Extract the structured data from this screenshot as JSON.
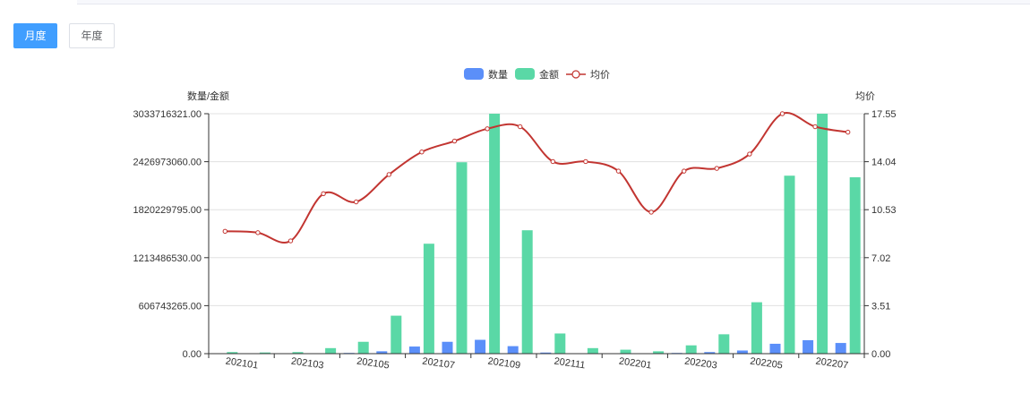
{
  "controls": {
    "month_label": "月度",
    "year_label": "年度"
  },
  "colors": {
    "quantity": "#5b8ff9",
    "amount": "#5ad8a6",
    "avg": "#c23531",
    "grid": "#e0e0e0",
    "axis": "#333333"
  },
  "chart_data": {
    "type": "bar",
    "legend": [
      "数量",
      "金额",
      "均价"
    ],
    "legend_position": "top-center",
    "ylabel_left": "数量/金额",
    "ylabel_right": "均价",
    "left_ticks": [
      "0.00",
      "606743265.00",
      "1213486530.00",
      "1820229795.00",
      "2426973060.00",
      "3033716321.00"
    ],
    "right_ticks": [
      "0.00",
      "3.51",
      "7.02",
      "10.53",
      "14.04",
      "17.55"
    ],
    "ylim_left": [
      0,
      3033716321
    ],
    "ylim_right": [
      0,
      17.55
    ],
    "categories": [
      "202101",
      "202102",
      "202103",
      "202104",
      "202105",
      "202106",
      "202107",
      "202108",
      "202109",
      "202110",
      "202111",
      "202112",
      "202201",
      "202202",
      "202203",
      "202204",
      "202205",
      "202206",
      "202207",
      "202208"
    ],
    "x_tick_labels": [
      "202101",
      "202103",
      "202105",
      "202107",
      "202109",
      "202111",
      "202201",
      "202203",
      "202205",
      "202207"
    ],
    "series": [
      {
        "name": "数量",
        "type": "bar",
        "axis": "left",
        "values": [
          2000000,
          1500000,
          2000000,
          5000000,
          9000000,
          30000000,
          90000000,
          150000000,
          175000000,
          95000000,
          14000000,
          4000000,
          5000000,
          3000000,
          9000000,
          20000000,
          40000000,
          125000000,
          170000000,
          135000000
        ]
      },
      {
        "name": "金额",
        "type": "bar",
        "axis": "left",
        "values": [
          20000000,
          15000000,
          20000000,
          70000000,
          150000000,
          480000000,
          1390000000,
          2420000000,
          3033716321,
          1560000000,
          255000000,
          70000000,
          50000000,
          30000000,
          105000000,
          245000000,
          650000000,
          2250000000,
          3033716321,
          2230000000
        ]
      },
      {
        "name": "均价",
        "type": "line",
        "axis": "right",
        "values": [
          8.95,
          8.85,
          8.25,
          11.7,
          11.1,
          13.1,
          14.75,
          15.55,
          16.45,
          16.6,
          14.05,
          14.05,
          13.35,
          10.35,
          13.35,
          13.55,
          14.6,
          17.55,
          16.6,
          16.2
        ]
      }
    ]
  }
}
